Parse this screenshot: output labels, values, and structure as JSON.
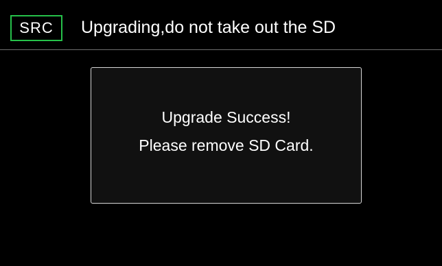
{
  "header": {
    "source_badge": "SRC",
    "title": "Upgrading,do not take out the SD"
  },
  "dialog": {
    "line1": "Upgrade Success!",
    "line2": "Please remove SD Card."
  },
  "colors": {
    "background": "#000000",
    "accent_green": "#26c14a",
    "divider": "#6e6e6e",
    "dialog_border": "#d8d8d8"
  }
}
